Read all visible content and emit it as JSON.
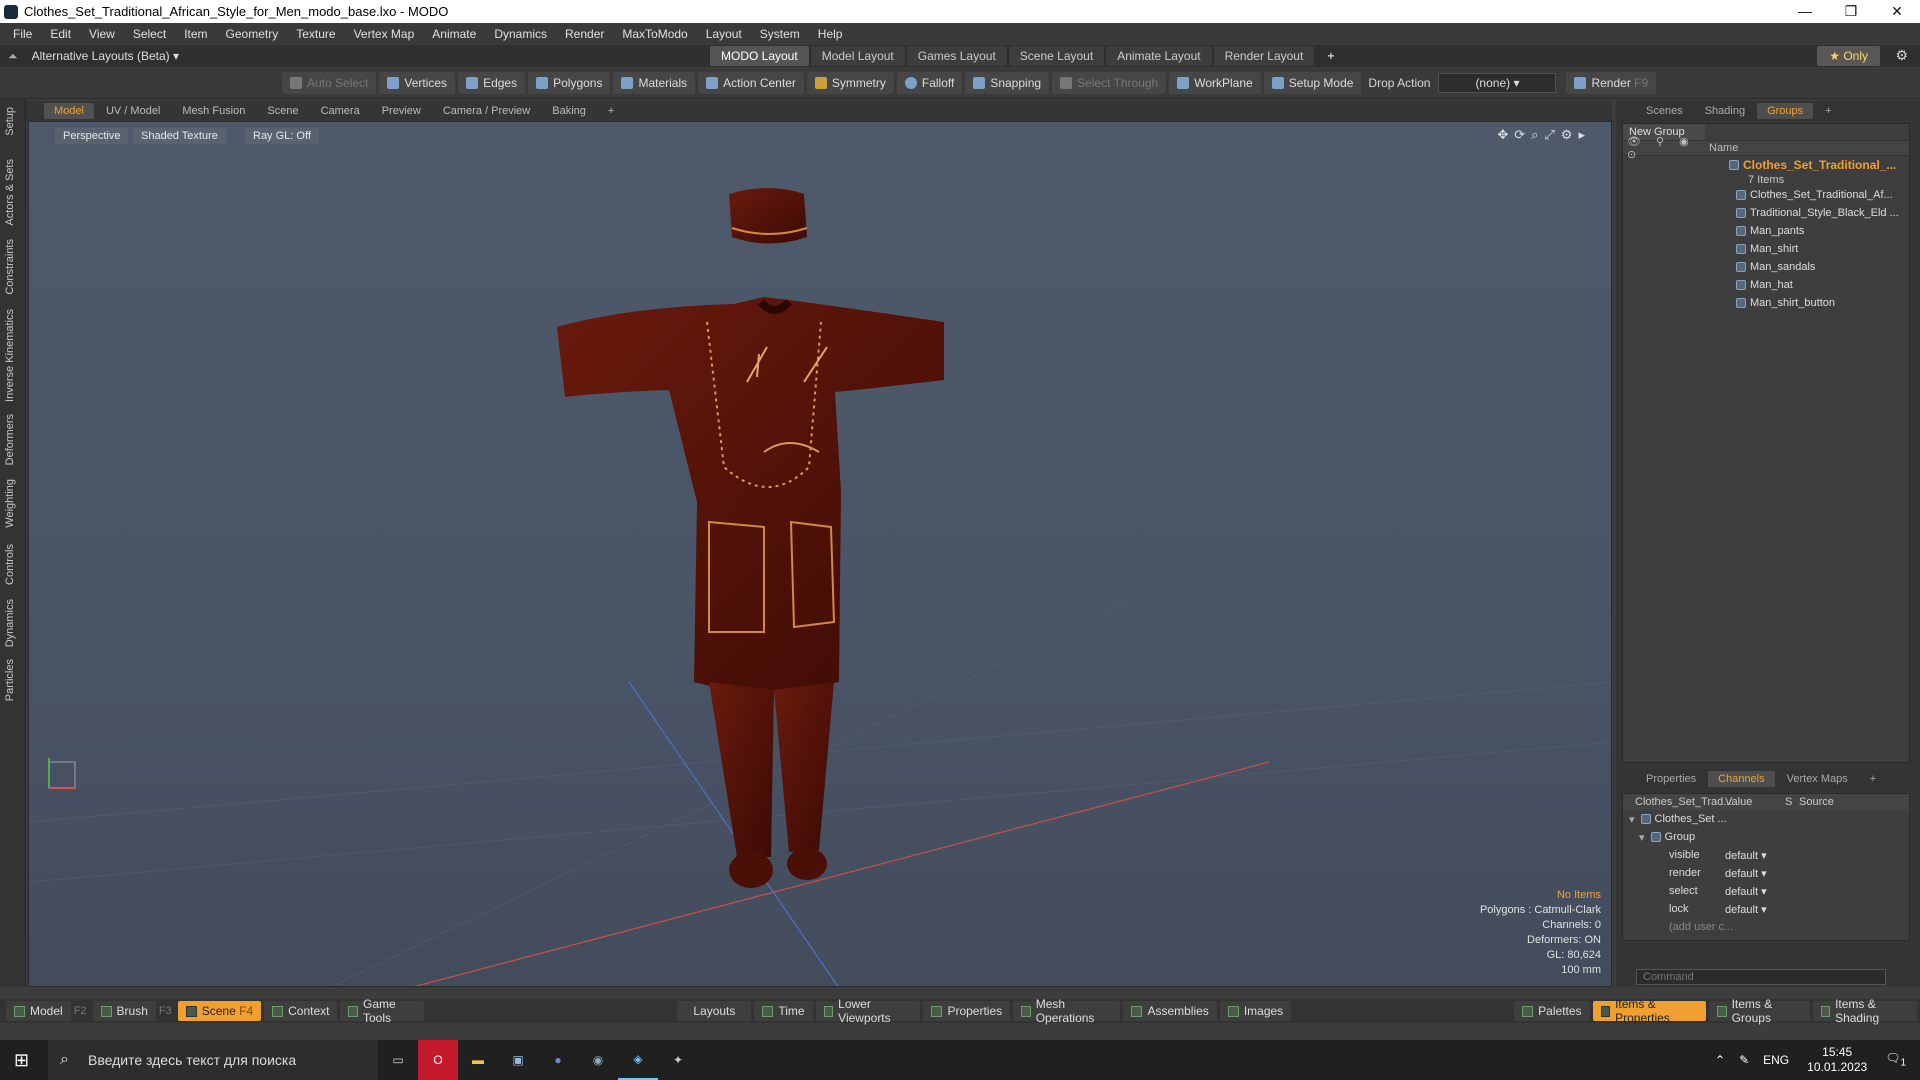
{
  "window": {
    "title": "Clothes_Set_Traditional_African_Style_for_Men_modo_base.lxo - MODO"
  },
  "menu": [
    "File",
    "Edit",
    "View",
    "Select",
    "Item",
    "Geometry",
    "Texture",
    "Vertex Map",
    "Animate",
    "Dynamics",
    "Render",
    "MaxToModo",
    "Layout",
    "System",
    "Help"
  ],
  "layout_bar": {
    "alt_layouts": "Alternative Layouts (Beta)",
    "tabs": [
      "MODO Layout",
      "Model Layout",
      "Games Layout",
      "Scene Layout",
      "Animate Layout",
      "Render Layout"
    ],
    "active_tab": "MODO Layout",
    "only": "Only"
  },
  "toolbar": {
    "auto_select": "Auto Select",
    "vertices": "Vertices",
    "edges": "Edges",
    "polygons": "Polygons",
    "materials": "Materials",
    "action_center": "Action Center",
    "symmetry": "Symmetry",
    "falloff": "Falloff",
    "snapping": "Snapping",
    "select_through": "Select Through",
    "workplane": "WorkPlane",
    "setup_mode": "Setup Mode",
    "drop_action": "Drop Action",
    "drop_value": "(none)",
    "render": "Render",
    "render_key": "F9"
  },
  "left_tabs": [
    "Setup",
    "Actors & Sets",
    "Constraints",
    "Inverse Kinematics",
    "Deformers",
    "Weighting",
    "Controls",
    "Dynamics",
    "Particles"
  ],
  "viewport_tabs": [
    "Model",
    "UV / Model",
    "Mesh Fusion",
    "Scene",
    "Camera",
    "Preview",
    "Camera / Preview",
    "Baking"
  ],
  "viewport": {
    "perspective": "Perspective",
    "shading": "Shaded Texture",
    "raygl": "Ray GL: Off",
    "info": {
      "no_items": "No Items",
      "polygons": "Polygons : Catmull-Clark",
      "channels": "Channels: 0",
      "deformers": "Deformers: ON",
      "gl": "GL: 80,624",
      "scale": "100 mm"
    }
  },
  "right_panel": {
    "tabs": [
      "Scenes",
      "Shading",
      "Groups"
    ],
    "new_group": "New Group",
    "name_header": "Name",
    "root": "Clothes_Set_Traditional_...",
    "count": "7 Items",
    "items": [
      "Clothes_Set_Traditional_Af...",
      "Traditional_Style_Black_Eld ...",
      "Man_pants",
      "Man_shirt",
      "Man_sandals",
      "Man_hat",
      "Man_shirt_button"
    ],
    "lower_tabs": [
      "Properties",
      "Channels",
      "Vertex Maps"
    ],
    "chan_header": {
      "name": "Clothes_Set_Trad...",
      "value": "Value",
      "s": "S",
      "source": "Source"
    },
    "chan_root": "Clothes_Set ...",
    "chan_group": "Group",
    "channels": [
      {
        "name": "visible",
        "value": "default"
      },
      {
        "name": "render",
        "value": "default"
      },
      {
        "name": "select",
        "value": "default"
      },
      {
        "name": "lock",
        "value": "default"
      }
    ],
    "add_user": "(add user c...",
    "command": "Command"
  },
  "bottom_bar": {
    "model": "Model",
    "model_key": "F2",
    "brush": "Brush",
    "brush_key": "F3",
    "scene": "Scene",
    "scene_key": "F4",
    "context": "Context",
    "game_tools": "Game Tools",
    "layouts": "Layouts",
    "time": "Time",
    "lower_viewports": "Lower Viewports",
    "properties": "Properties",
    "mesh_ops": "Mesh Operations",
    "assemblies": "Assemblies",
    "images": "Images",
    "palettes": "Palettes",
    "items_props": "Items & Properties",
    "items_groups": "Items & Groups",
    "items_shading": "Items & Shading"
  },
  "taskbar": {
    "search": "Введите здесь текст для поиска",
    "lang": "ENG",
    "time": "15:45",
    "date": "10.01.2023",
    "notif": "1"
  }
}
